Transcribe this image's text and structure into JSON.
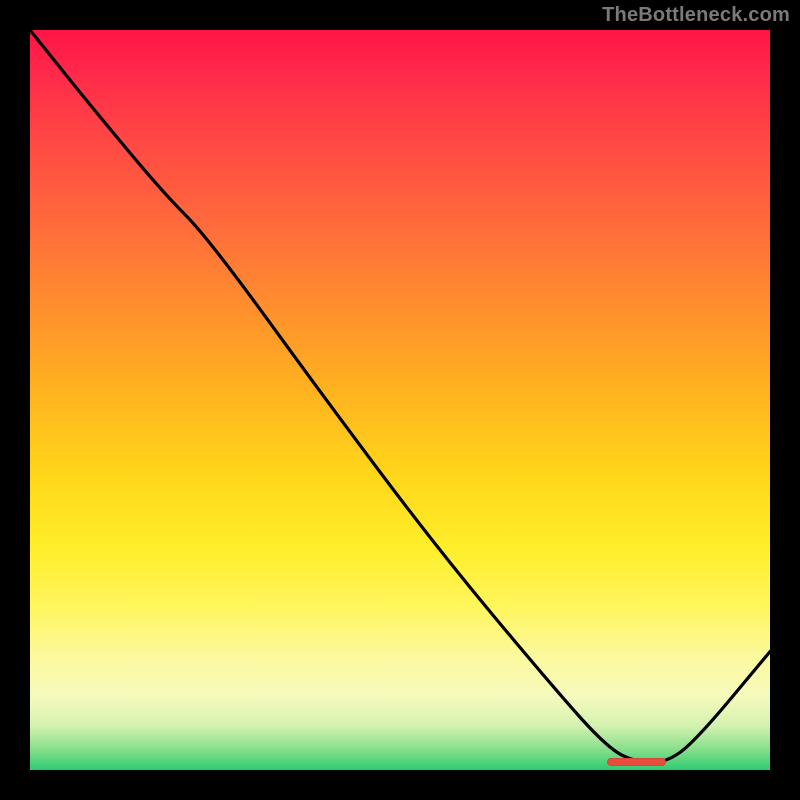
{
  "watermark": "TheBottleneck.com",
  "colors": {
    "gradient_top": "#ff1446",
    "gradient_mid": "#ffd61a",
    "gradient_bottom": "#2ecc71",
    "curve": "#000000",
    "marker": "#e74c3c",
    "frame": "#000000"
  },
  "chart_data": {
    "type": "line",
    "title": "",
    "xlabel": "",
    "ylabel": "",
    "xlim": [
      0,
      100
    ],
    "ylim": [
      0,
      100
    ],
    "grid": false,
    "legend": false,
    "series": [
      {
        "name": "bottleneck-curve",
        "x": [
          0,
          8,
          18,
          24,
          40,
          55,
          70,
          78,
          82,
          86,
          90,
          100
        ],
        "y": [
          100,
          90,
          78,
          72,
          50,
          30,
          12,
          3,
          1,
          1,
          4,
          16
        ]
      }
    ],
    "annotations": [
      {
        "name": "optimal-range-marker",
        "x_start": 78,
        "x_end": 86,
        "y": 1
      }
    ],
    "background_gradient": {
      "direction": "vertical",
      "stops": [
        {
          "pos": 0,
          "color": "#ff1446"
        },
        {
          "pos": 50,
          "color": "#ffc020"
        },
        {
          "pos": 80,
          "color": "#fff65e"
        },
        {
          "pos": 100,
          "color": "#2ecc71"
        }
      ]
    }
  }
}
